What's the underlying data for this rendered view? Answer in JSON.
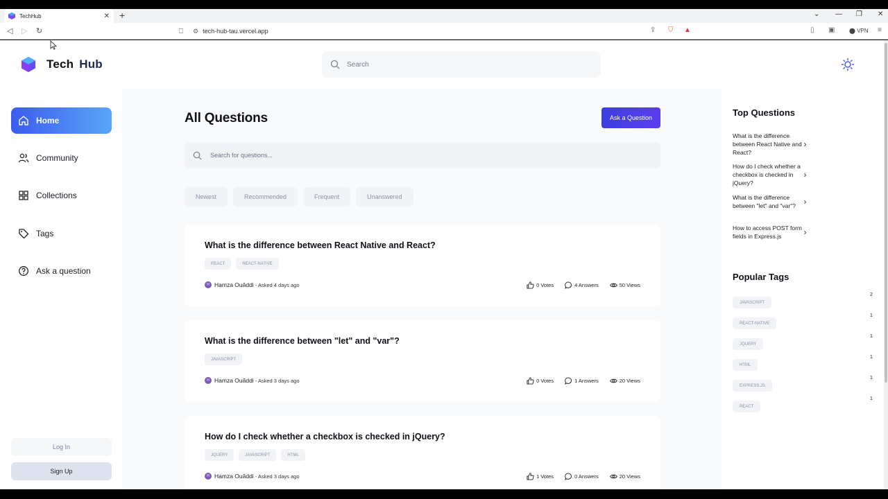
{
  "browser": {
    "tab_title": "TechHub",
    "url": "tech-hub-tau.vercel.app",
    "vpn_label": "VPN"
  },
  "topnav": {
    "logo_text_a": "Tech",
    "logo_text_b": "Hub",
    "search_placeholder": "Search"
  },
  "sidebar": {
    "items": [
      {
        "label": "Home"
      },
      {
        "label": "Community"
      },
      {
        "label": "Collections"
      },
      {
        "label": "Tags"
      },
      {
        "label": "Ask a question"
      }
    ],
    "login_label": "Log In",
    "signup_label": "Sign Up"
  },
  "main": {
    "title": "All Questions",
    "ask_button": "Ask a Question",
    "search_placeholder": "Search for questions...",
    "filters": [
      "Newest",
      "Recommended",
      "Frequent",
      "Unanswered"
    ],
    "questions": [
      {
        "title": "What is the difference between React Native and React?",
        "tags": [
          "REACT",
          "REACT-NATIVE"
        ],
        "author_initial": "H",
        "author": "Hamza Ouâddi",
        "asked": "- Asked 4 days ago",
        "votes": "0 Votes",
        "answers": "4 Answers",
        "views": "50 Views"
      },
      {
        "title": "What is the difference between \"let\" and \"var\"?",
        "tags": [
          "JAVASCRIPT"
        ],
        "author_initial": "H",
        "author": "Hamza Ouâddi",
        "asked": "- Asked 3 days ago",
        "votes": "0 Votes",
        "answers": "1 Answers",
        "views": "20 Views"
      },
      {
        "title": "How do I check whether a checkbox is checked in jQuery?",
        "tags": [
          "JQUERY",
          "JAVASCRIPT",
          "HTML"
        ],
        "author_initial": "H",
        "author": "Hamza Ouâddi",
        "asked": "- Asked 3 days ago",
        "votes": "1 Votes",
        "answers": "0 Answers",
        "views": "20 Views"
      }
    ]
  },
  "rightbar": {
    "top_title": "Top Questions",
    "top_questions": [
      "What is the difference between React Native and React?",
      "How do I check whether a checkbox is checked in jQuery?",
      "What is the difference between \"let\" and \"var\"?",
      "How to access POST form fields in Express.js"
    ],
    "tags_title": "Popular Tags",
    "popular_tags": [
      {
        "name": "JAVASCRIPT",
        "count": "2"
      },
      {
        "name": "REACT-NATIVE",
        "count": "1"
      },
      {
        "name": "JQUERY",
        "count": "1"
      },
      {
        "name": "HTML",
        "count": "1"
      },
      {
        "name": "EXPRESS.JS",
        "count": "1"
      },
      {
        "name": "REACT",
        "count": "1"
      }
    ]
  },
  "colors": {
    "accent_gradient_start": "#3c5cf0",
    "accent_gradient_end": "#58a6f7",
    "ask_button": "#3b3fe0"
  }
}
